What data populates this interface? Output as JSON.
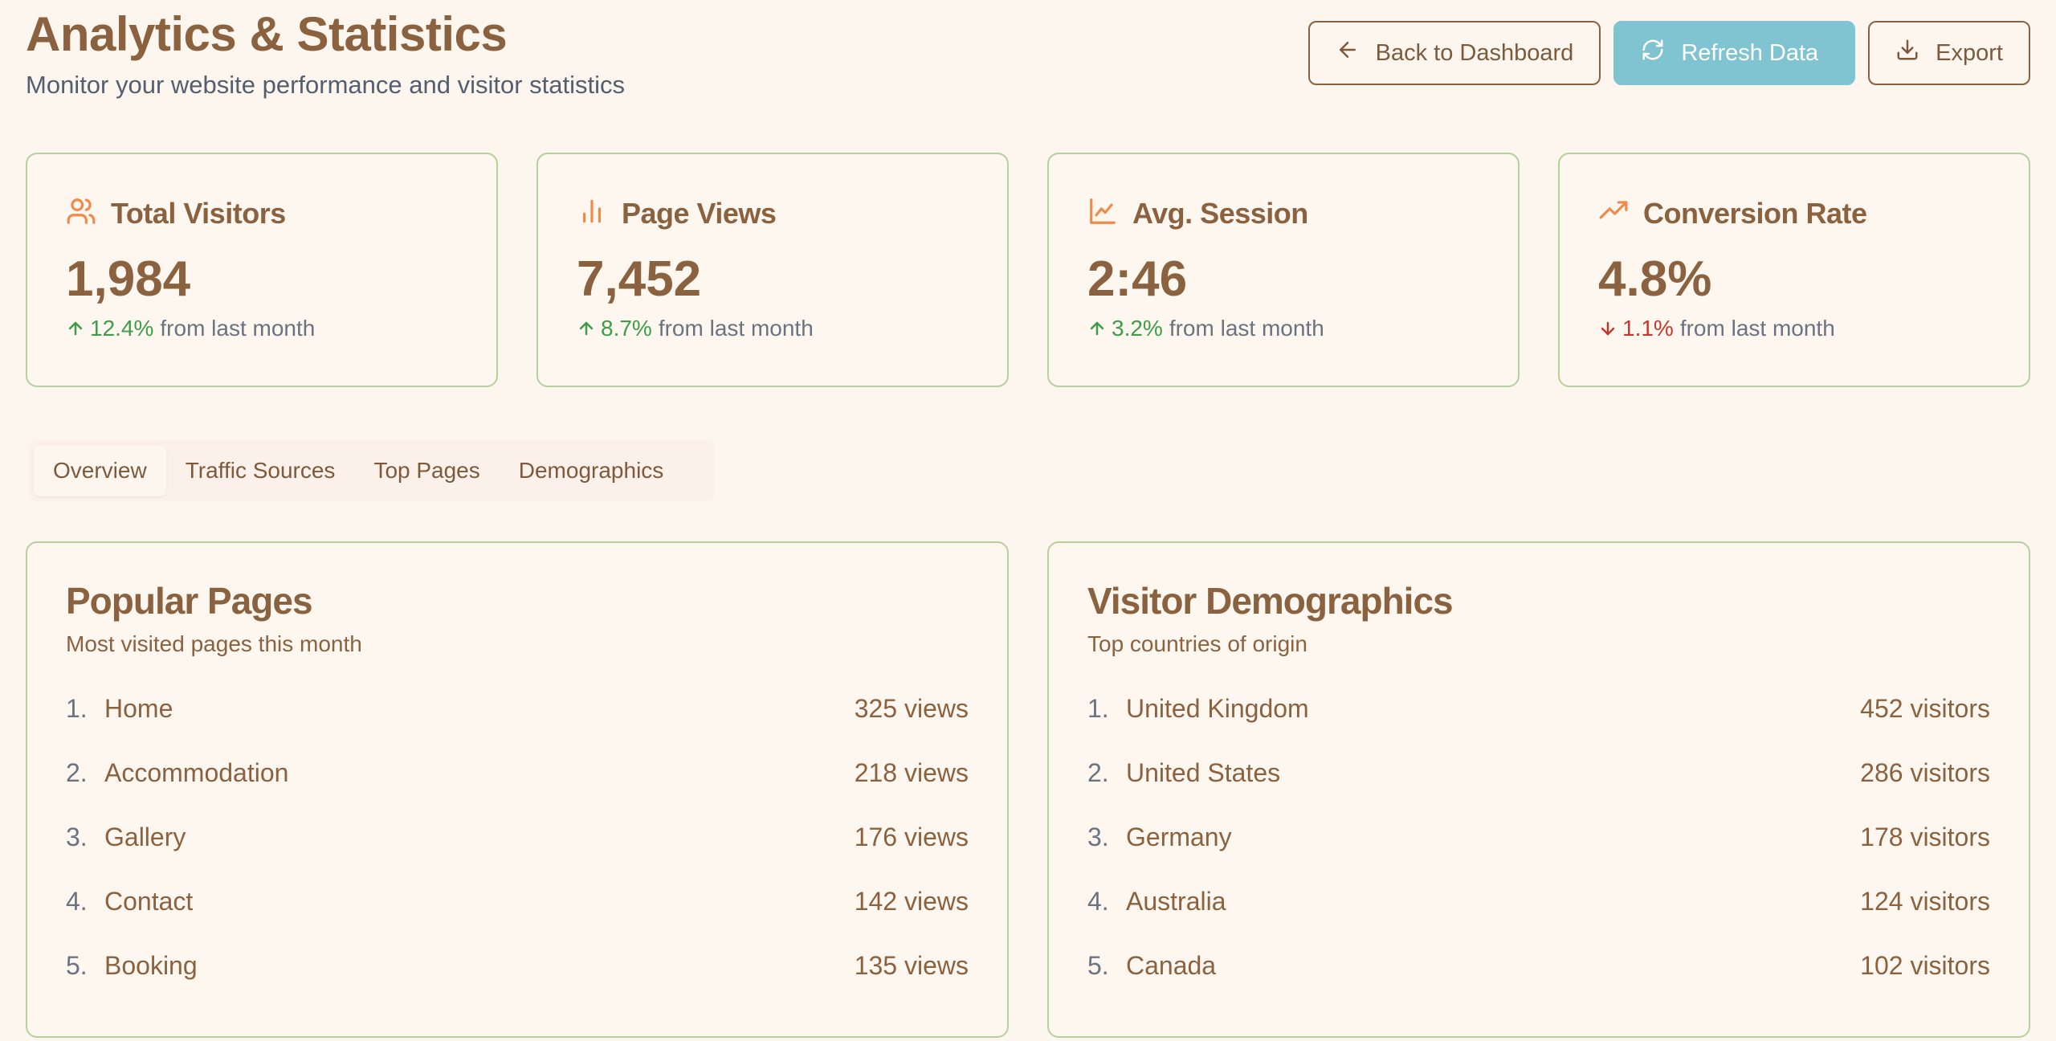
{
  "header": {
    "title": "Analytics & Statistics",
    "subtitle": "Monitor your website performance and visitor statistics"
  },
  "actions": {
    "back_label": "Back to Dashboard",
    "refresh_label": "Refresh Data",
    "export_label": "Export"
  },
  "colors": {
    "accent": "#8b6240",
    "primary_button": "#80c3d1",
    "card_border": "#b8cfa0",
    "icon": "#f08a4b",
    "up": "#3f9c4a",
    "down": "#c0392b"
  },
  "stats": [
    {
      "label": "Total Visitors",
      "icon": "users-icon",
      "value": "1,984",
      "delta": "12.4%",
      "direction": "up",
      "suffix": "from last month"
    },
    {
      "label": "Page Views",
      "icon": "bar-chart-icon",
      "value": "7,452",
      "delta": "8.7%",
      "direction": "up",
      "suffix": "from last month"
    },
    {
      "label": "Avg. Session",
      "icon": "line-chart-icon",
      "value": "2:46",
      "delta": "3.2%",
      "direction": "up",
      "suffix": "from last month"
    },
    {
      "label": "Conversion Rate",
      "icon": "trending-up-icon",
      "value": "4.8%",
      "delta": "1.1%",
      "direction": "down",
      "suffix": "from last month"
    }
  ],
  "tabs": [
    {
      "label": "Overview",
      "active": true
    },
    {
      "label": "Traffic Sources",
      "active": false
    },
    {
      "label": "Top Pages",
      "active": false
    },
    {
      "label": "Demographics",
      "active": false
    }
  ],
  "popular_pages": {
    "title": "Popular Pages",
    "subtitle": "Most visited pages this month",
    "items": [
      {
        "rank": "1.",
        "name": "Home",
        "value": "325 views"
      },
      {
        "rank": "2.",
        "name": "Accommodation",
        "value": "218 views"
      },
      {
        "rank": "3.",
        "name": "Gallery",
        "value": "176 views"
      },
      {
        "rank": "4.",
        "name": "Contact",
        "value": "142 views"
      },
      {
        "rank": "5.",
        "name": "Booking",
        "value": "135 views"
      }
    ]
  },
  "demographics": {
    "title": "Visitor Demographics",
    "subtitle": "Top countries of origin",
    "items": [
      {
        "rank": "1.",
        "name": "United Kingdom",
        "value": "452 visitors"
      },
      {
        "rank": "2.",
        "name": "United States",
        "value": "286 visitors"
      },
      {
        "rank": "3.",
        "name": "Germany",
        "value": "178 visitors"
      },
      {
        "rank": "4.",
        "name": "Australia",
        "value": "124 visitors"
      },
      {
        "rank": "5.",
        "name": "Canada",
        "value": "102 visitors"
      }
    ]
  }
}
